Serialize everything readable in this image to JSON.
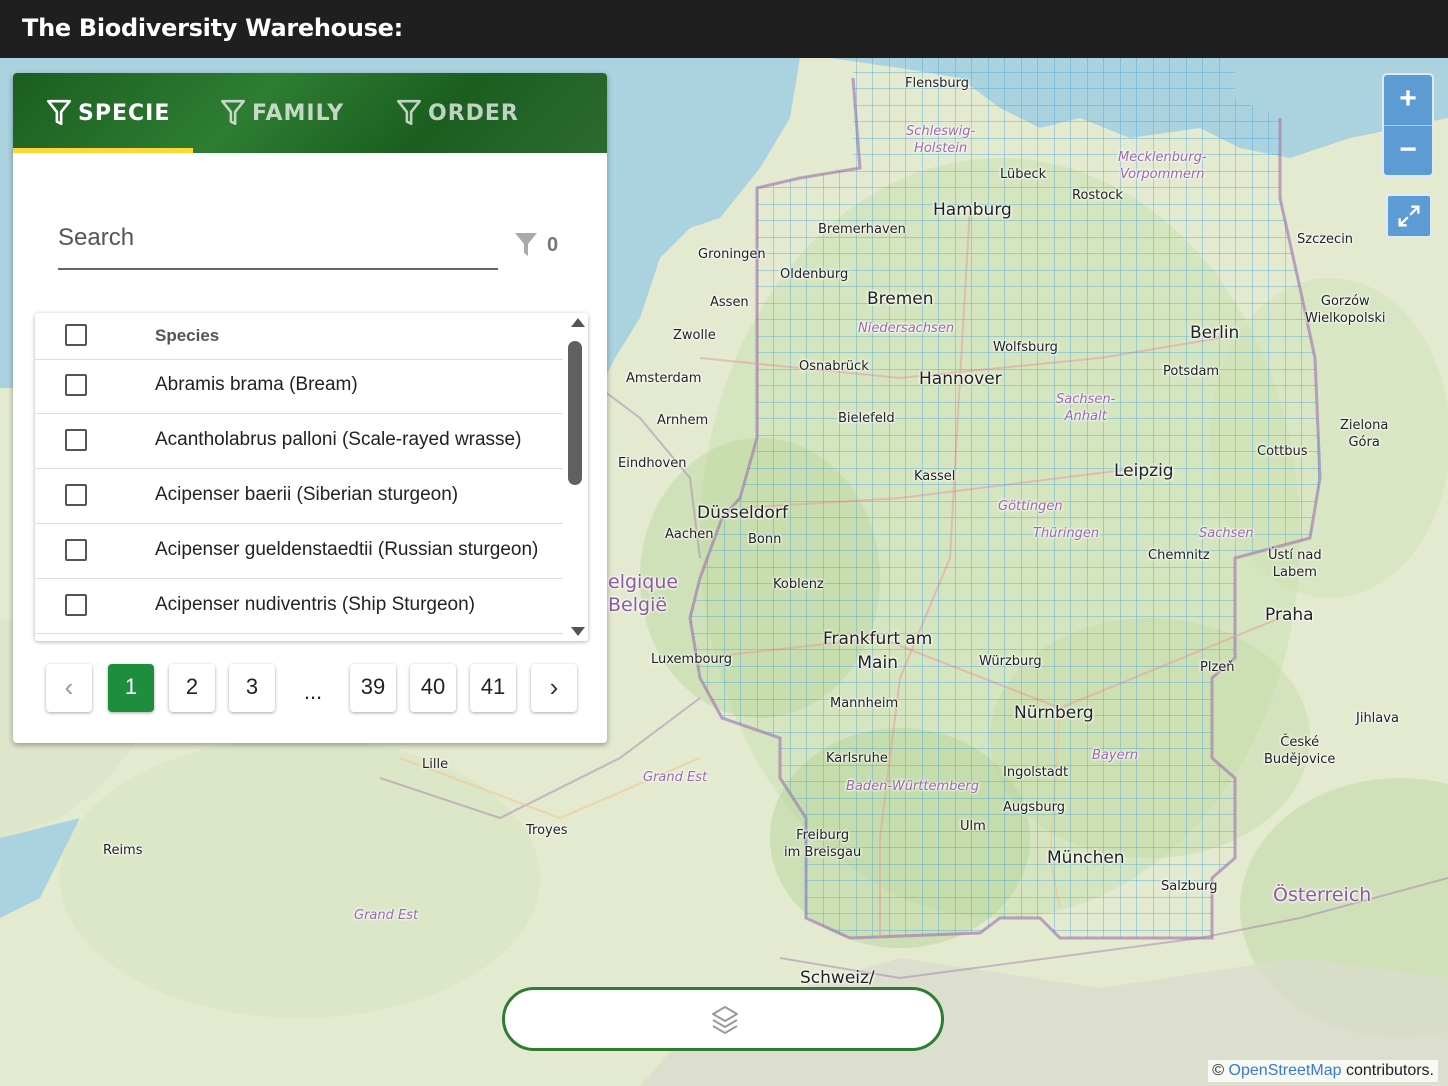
{
  "app": {
    "title": "The Biodiversity Warehouse:"
  },
  "tabs": [
    {
      "label": "SPECIE",
      "icon": "filter-icon",
      "active": true
    },
    {
      "label": "FAMILY",
      "icon": "filter-icon",
      "active": false
    },
    {
      "label": "ORDER",
      "icon": "filter-icon",
      "active": false
    }
  ],
  "search": {
    "placeholder": "Search",
    "value": "",
    "filter_count": "0"
  },
  "table": {
    "header": "Species",
    "rows": [
      "Abramis brama (Bream)",
      "Acantholabrus palloni (Scale-rayed wrasse)",
      "Acipenser baerii (Siberian sturgeon)",
      "Acipenser gueldenstaedtii (Russian sturgeon)",
      "Acipenser nudiventris (Ship Sturgeon)"
    ]
  },
  "pagination": {
    "prev": "‹",
    "pages": [
      "1",
      "2",
      "3",
      "...",
      "39",
      "40",
      "41"
    ],
    "current": "1",
    "next": "›"
  },
  "map": {
    "zoom_in": "+",
    "zoom_out": "−",
    "fullscreen_icon": "expand-icon",
    "layers_icon": "layers-icon",
    "attribution_symbol": "©",
    "attribution_link": "OpenStreetMap",
    "attribution_text": "contributors.",
    "places": {
      "flensburg": "Flensburg",
      "schleswig": "Schleswig-\nHolstein",
      "mecklenburg": "Mecklenburg-\nVorpommern",
      "lubeck": "Lübeck",
      "rostock": "Rostock",
      "hamburg": "Hamburg",
      "bremerhaven": "Bremerhaven",
      "groningen": "Groningen",
      "oldenburg": "Oldenburg",
      "bremen": "Bremen",
      "szczecin": "Szczecin",
      "assen": "Assen",
      "gorzow": "Gorzów\nWielkopolski",
      "niedersachsen": "Niedersachsen",
      "zwolle": "Zwolle",
      "berlin": "Berlin",
      "wolfsburg": "Wolfsburg",
      "amsterdam": "Amsterdam",
      "osnabruck": "Osnabrück",
      "hannover": "Hannover",
      "potsdam": "Potsdam",
      "sachsen_anhalt": "Sachsen-\nAnhalt",
      "arnhem": "Arnhem",
      "bielefeld": "Bielefeld",
      "zielona": "Zielona\nGóra",
      "eindhoven": "Eindhoven",
      "cottbus": "Cottbus",
      "kassel": "Kassel",
      "leipzig": "Leipzig",
      "gottingen": "Göttingen",
      "dusseldorf": "Düsseldorf",
      "aachen": "Aachen",
      "bonn": "Bonn",
      "thuringen": "Thüringen",
      "sachsen": "Sachsen",
      "chemnitz": "Chemnitz",
      "usti": "Ústí nad\nLabem",
      "belgique": "elgique\nBelgië",
      "koblenz": "Koblenz",
      "praha": "Praha",
      "frankfurt": "Frankfurt am\nMain",
      "luxembourg": "Luxembourg",
      "wurzburg": "Würzburg",
      "plzen": "Plzeň",
      "mannheim": "Mannheim",
      "nurnberg": "Nürnberg",
      "jihlava": "Jihlava",
      "karlsruhe": "Karlsruhe",
      "bayern": "Bayern",
      "ceske": "České\nBudějovice",
      "lille": "Lille",
      "grand_est_1": "Grand Est",
      "ingolstadt": "Ingolstadt",
      "baden": "Baden-Württemberg",
      "augsburg": "Augsburg",
      "troyes": "Troyes",
      "ulm": "Ulm",
      "freiburg": "Freiburg\nim Breisgau",
      "reims": "Reims",
      "munchen": "München",
      "salzburg": "Salzburg",
      "osterreich": "Österreich",
      "grand_est_2": "Grand Est",
      "schweiz": "Schweiz/"
    }
  }
}
